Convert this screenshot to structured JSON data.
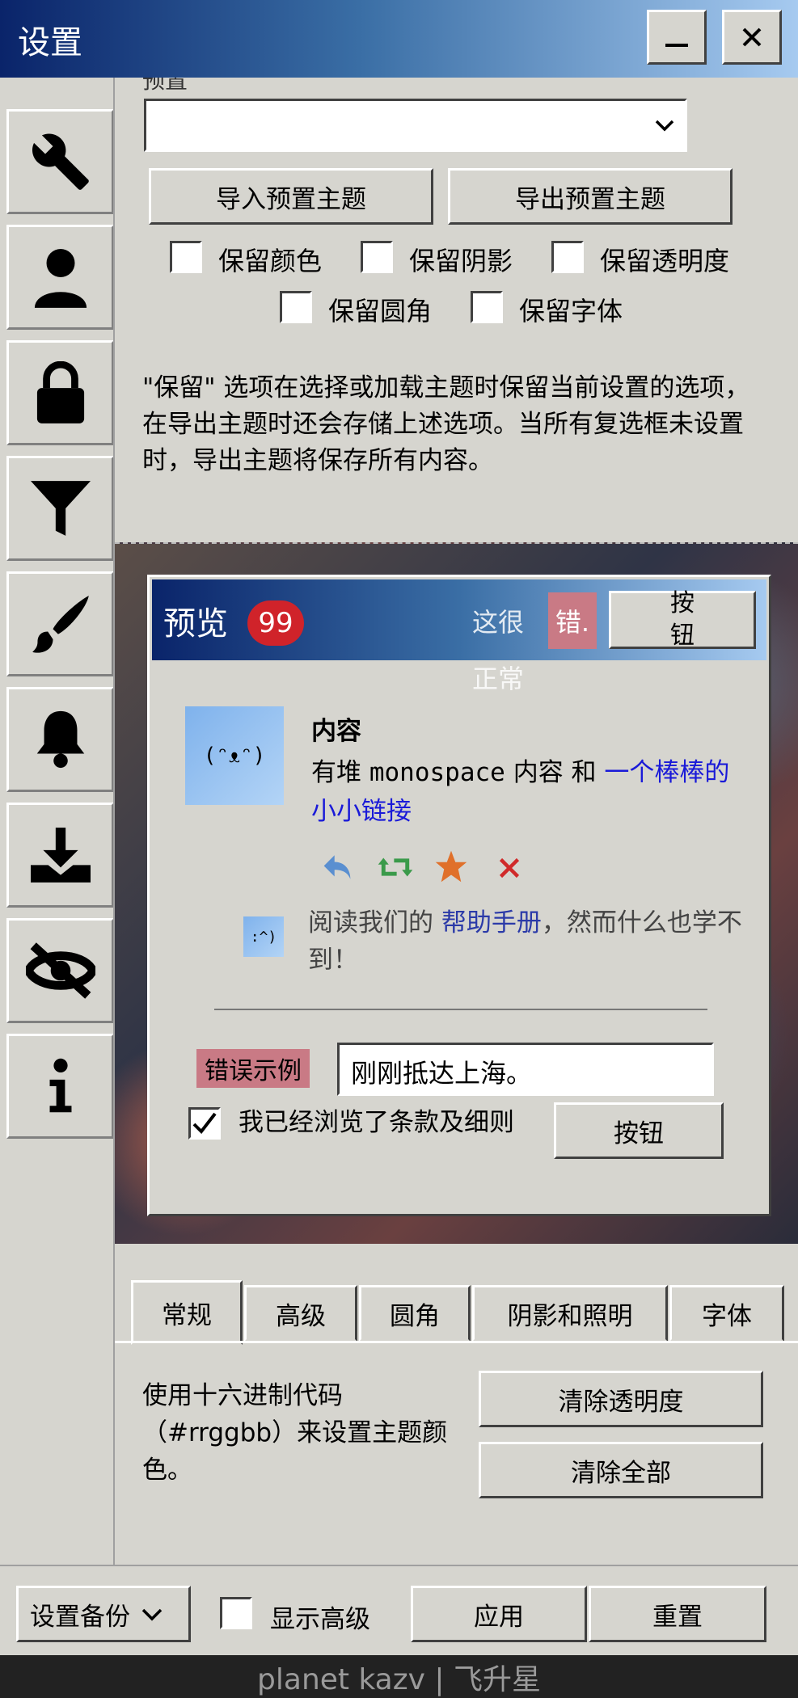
{
  "window": {
    "title": "设置",
    "minimize_label": "_",
    "close_label": "✕"
  },
  "sidebar": {
    "items": [
      {
        "icon": "wrench-icon"
      },
      {
        "icon": "user-icon"
      },
      {
        "icon": "lock-icon"
      },
      {
        "icon": "filter-icon"
      },
      {
        "icon": "brush-icon"
      },
      {
        "icon": "bell-icon"
      },
      {
        "icon": "download-icon"
      },
      {
        "icon": "eye-off-icon"
      },
      {
        "icon": "info-icon"
      }
    ]
  },
  "preset": {
    "label": "预置",
    "value": "",
    "import_label": "导入预置主题",
    "export_label": "导出预置主题",
    "keep_color": "保留颜色",
    "keep_shadow": "保留阴影",
    "keep_opacity": "保留透明度",
    "keep_radius": "保留圆角",
    "keep_font": "保留字体",
    "note": "\"保留\" 选项在选择或加载主题时保留当前设置的选项，在导出主题时还会存储上述选项。当所有复选框未设置时，导出主题将保存所有内容。"
  },
  "preview": {
    "title": "预览",
    "badge": "99",
    "faint_text_1": "这很",
    "faint_text_2": "正常",
    "error_chip": "错.",
    "header_button": "按\n钮",
    "avatar_face": "(ᵔᴥᵔ)",
    "content_heading": "内容",
    "content_text_1": "有堆 ",
    "content_mono": "monospace",
    "content_text_2": " 内容 和 ",
    "content_link": "一个棒棒的小小链接",
    "small_avatar": ":^)",
    "help_text_1": "阅读我们的 ",
    "help_link": "帮助手册",
    "help_text_2": "，然而什么也学不到！",
    "error_example_label": "错误示例",
    "error_example_value": "刚刚抵达上海。",
    "terms_label": "我已经浏览了条款及细则",
    "terms_checked": true,
    "button_label": "按钮"
  },
  "tabs": {
    "items": [
      "常规",
      "高级",
      "圆角",
      "阴影和照明",
      "字体"
    ],
    "active": 0
  },
  "general": {
    "description": "使用十六进制代码（#rrggbb）来设置主题颜色。",
    "clear_opacity": "清除透明度",
    "clear_all": "清除全部"
  },
  "bottom_bar": {
    "backup_label": "设置备份",
    "show_advanced": "显示高级",
    "apply": "应用",
    "reset": "重置"
  },
  "footer": {
    "text": "planet kazv | 飞升星"
  },
  "colors": {
    "title_gradient_start": "#0a246a",
    "title_gradient_end": "#a6caf0",
    "window_bg": "#d6d5cf",
    "badge": "#d0232a",
    "link": "#1a1ad8",
    "error_bg": "#c97a85",
    "reply_icon": "#5a8fd0",
    "retweet_icon": "#3a9a4a",
    "star_icon": "#e0702a",
    "cancel_icon": "#d02a2a"
  }
}
